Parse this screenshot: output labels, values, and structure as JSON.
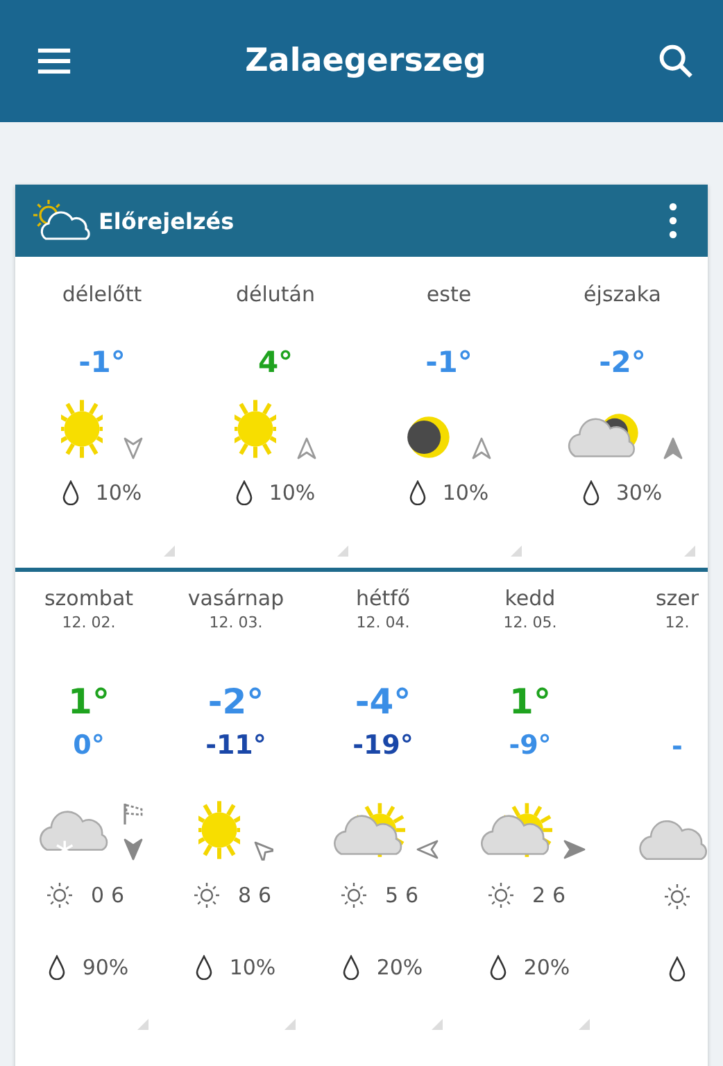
{
  "app_bar": {
    "title": "Zalaegerszeg"
  },
  "forecast_card": {
    "title": "Előrejelzés",
    "periods": [
      {
        "label": "délelőtt",
        "temp": "-1°",
        "color": "#3a8ee6",
        "icon": {
          "kind": "sun"
        },
        "wind": {
          "kind": "s"
        },
        "wind_filled": false,
        "precip": "10%"
      },
      {
        "label": "délután",
        "temp": "4°",
        "color": "#1fa31f",
        "icon": {
          "kind": "sun"
        },
        "wind": {
          "kind": "n"
        },
        "wind_filled": false,
        "precip": "10%"
      },
      {
        "label": "este",
        "temp": "-1°",
        "color": "#3a8ee6",
        "icon": {
          "kind": "moon"
        },
        "wind": {
          "kind": "n"
        },
        "wind_filled": false,
        "precip": "10%"
      },
      {
        "label": "éjszaka",
        "temp": "-2°",
        "color": "#3a8ee6",
        "icon": {
          "kind": "cloudmoon"
        },
        "wind": {
          "kind": "n"
        },
        "wind_filled": true,
        "precip": "30%"
      }
    ],
    "days": [
      {
        "day": "szombat",
        "date": "12. 02.",
        "high": {
          "text": "1°",
          "color": "#1fa31f"
        },
        "low": {
          "text": "0°",
          "color": "#3a8ee6"
        },
        "icon": {
          "kind": "cloudsnow"
        },
        "gust": true,
        "wind": {
          "kind": "s"
        },
        "wind_filled": true,
        "sun_hours": "06",
        "precip": "90%"
      },
      {
        "day": "vasárnap",
        "date": "12. 03.",
        "high": {
          "text": "-2°",
          "color": "#3a8ee6"
        },
        "low": {
          "text": "-11°",
          "color": "#1a47a8"
        },
        "icon": {
          "kind": "sun"
        },
        "gust": false,
        "wind": {
          "kind": "nw"
        },
        "wind_filled": false,
        "sun_hours": "86",
        "precip": "10%"
      },
      {
        "day": "hétfő",
        "date": "12. 04.",
        "high": {
          "text": "-4°",
          "color": "#3a8ee6"
        },
        "low": {
          "text": "-19°",
          "color": "#1a47a8"
        },
        "icon": {
          "kind": "cloudsun"
        },
        "gust": false,
        "wind": {
          "kind": "w"
        },
        "wind_filled": false,
        "sun_hours": "56",
        "precip": "20%"
      },
      {
        "day": "kedd",
        "date": "12. 05.",
        "high": {
          "text": "1°",
          "color": "#1fa31f"
        },
        "low": {
          "text": "-9°",
          "color": "#3a8ee6"
        },
        "icon": {
          "kind": "cloudsun"
        },
        "gust": false,
        "wind": {
          "kind": "e"
        },
        "wind_filled": true,
        "sun_hours": "26",
        "precip": "20%"
      },
      {
        "day": "szer",
        "date": "12.",
        "low": {
          "text": "-",
          "color": "#3a8ee6"
        },
        "icon": {
          "kind": "cloud"
        }
      }
    ]
  }
}
